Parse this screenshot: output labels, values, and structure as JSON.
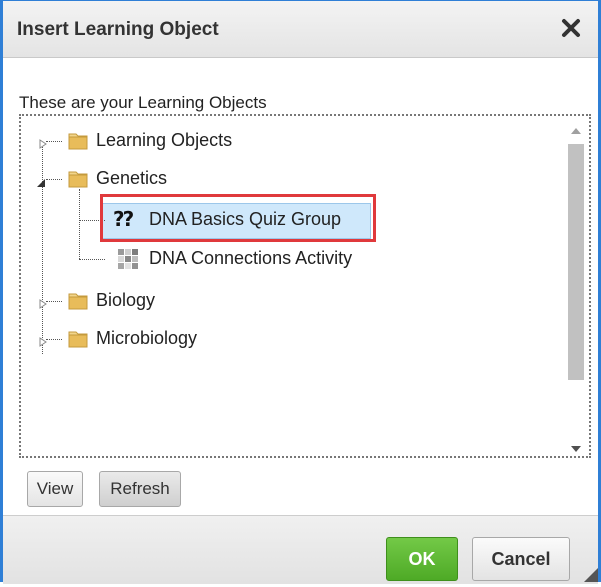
{
  "dialog": {
    "title": "Insert Learning Object",
    "close_icon": "close-icon"
  },
  "intro_text": "These are your Learning Objects",
  "tree": {
    "nodes": [
      {
        "label": "Learning Objects",
        "icon": "folder-icon",
        "expanded": false
      },
      {
        "label": "Genetics",
        "icon": "folder-icon",
        "expanded": true,
        "children": [
          {
            "label": "DNA Basics Quiz Group",
            "icon": "quiz-icon",
            "icon_text": "??",
            "selected": true
          },
          {
            "label": "DNA Connections Activity",
            "icon": "activity-icon"
          }
        ]
      },
      {
        "label": "Biology",
        "icon": "folder-icon",
        "expanded": false
      },
      {
        "label": "Microbiology",
        "icon": "folder-icon",
        "expanded": false
      }
    ]
  },
  "buttons": {
    "view": "View",
    "refresh": "Refresh",
    "ok": "OK",
    "cancel": "Cancel"
  },
  "colors": {
    "accent_border": "#2f7fd6",
    "ok_green": "#5db534",
    "selection": "#cfe8fb",
    "callout_red": "#e0393c",
    "folder": "#e0b65a"
  }
}
